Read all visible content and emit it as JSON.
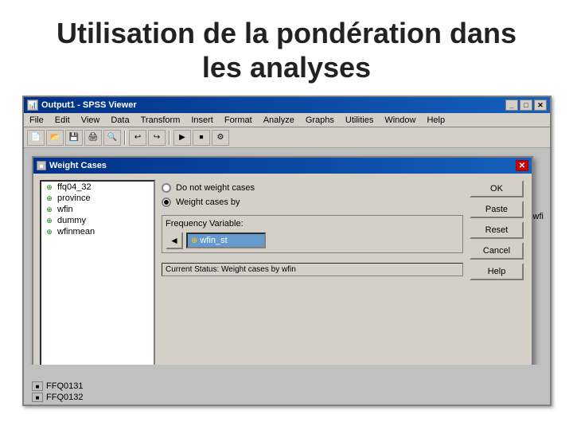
{
  "slide": {
    "title_line1": "Utilisation de la pondération dans",
    "title_line2": "les analyses"
  },
  "spss_window": {
    "title": "Output1 - SPSS Viewer",
    "menubar": {
      "items": [
        "File",
        "Edit",
        "View",
        "Data",
        "Transform",
        "Insert",
        "Format",
        "Analyze",
        "Graphs",
        "Utilities",
        "Window",
        "Help"
      ]
    }
  },
  "dialog": {
    "title": "Weight Cases",
    "variables": [
      {
        "name": "ffq04_32"
      },
      {
        "name": "province"
      },
      {
        "name": "wfin"
      },
      {
        "name": "dummy"
      },
      {
        "name": "wfinmean"
      }
    ],
    "radio_options": {
      "no_weight": "Do not weight cases",
      "weight_by": "Weight cases by"
    },
    "freq_variable_label": "Frequency Variable:",
    "freq_variable_value": "wfin_st",
    "current_status": "Current Status: Weight cases by wfin",
    "buttons": [
      "OK",
      "Paste",
      "Reset",
      "Cancel",
      "Help"
    ]
  },
  "bottom_items": [
    {
      "label": "FFQ0131"
    },
    {
      "label": "FFQ0132"
    }
  ],
  "side_text": "wfi"
}
